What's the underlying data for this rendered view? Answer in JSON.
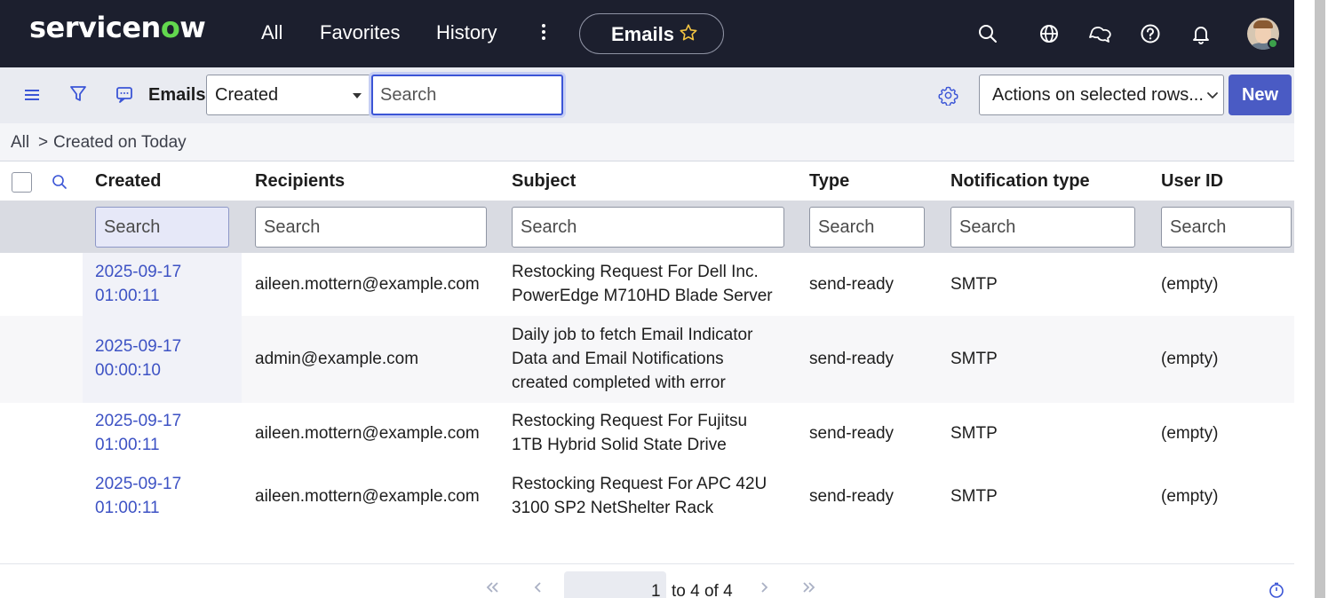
{
  "header": {
    "logo_prefix": "servicen",
    "logo_o": "o",
    "logo_suffix": "w",
    "nav": [
      "All",
      "Favorites",
      "History"
    ],
    "context_pill": "Emails",
    "icons": [
      "search-icon",
      "globe-icon",
      "chat-icon",
      "help-icon",
      "bell-icon"
    ]
  },
  "toolbar": {
    "title": "Emails",
    "field_select": "Created",
    "search_placeholder": "Search",
    "actions_select": "Actions on selected rows...",
    "new_label": "New"
  },
  "breadcrumb": {
    "root": "All",
    "separator": ">",
    "filter": "Created on Today"
  },
  "table": {
    "columns": [
      "Created",
      "Recipients",
      "Subject",
      "Type",
      "Notification type",
      "User ID"
    ],
    "search_placeholder": "Search",
    "rows": [
      {
        "created": [
          "2025-09-17",
          "01:00:11"
        ],
        "recipients": "aileen.mottern@example.com",
        "subject": [
          "Restocking Request For Dell Inc.",
          "PowerEdge M710HD Blade Server"
        ],
        "type": "send-ready",
        "notification_type": "SMTP",
        "user_id": "(empty)"
      },
      {
        "created": [
          "2025-09-17",
          "00:00:10"
        ],
        "recipients": "admin@example.com",
        "subject": [
          "Daily job to fetch Email Indicator",
          "Data and Email Notifications",
          "created completed with error"
        ],
        "type": "send-ready",
        "notification_type": "SMTP",
        "user_id": "(empty)"
      },
      {
        "created": [
          "2025-09-17",
          "01:00:11"
        ],
        "recipients": "aileen.mottern@example.com",
        "subject": [
          "Restocking Request For Fujitsu",
          "1TB Hybrid Solid State Drive"
        ],
        "type": "send-ready",
        "notification_type": "SMTP",
        "user_id": "(empty)"
      },
      {
        "created": [
          "2025-09-17",
          "01:00:11"
        ],
        "recipients": "aileen.mottern@example.com",
        "subject": [
          "Restocking Request For APC 42U",
          "3100 SP2 NetShelter Rack"
        ],
        "type": "send-ready",
        "notification_type": "SMTP",
        "user_id": "(empty)"
      }
    ]
  },
  "pagination": {
    "current": "1",
    "range_text": "to 4 of 4"
  },
  "colors": {
    "header_bg": "#1c1f2e",
    "logo_accent": "#62d84e",
    "primary": "#4a5bc4",
    "link": "#3d52c4"
  }
}
